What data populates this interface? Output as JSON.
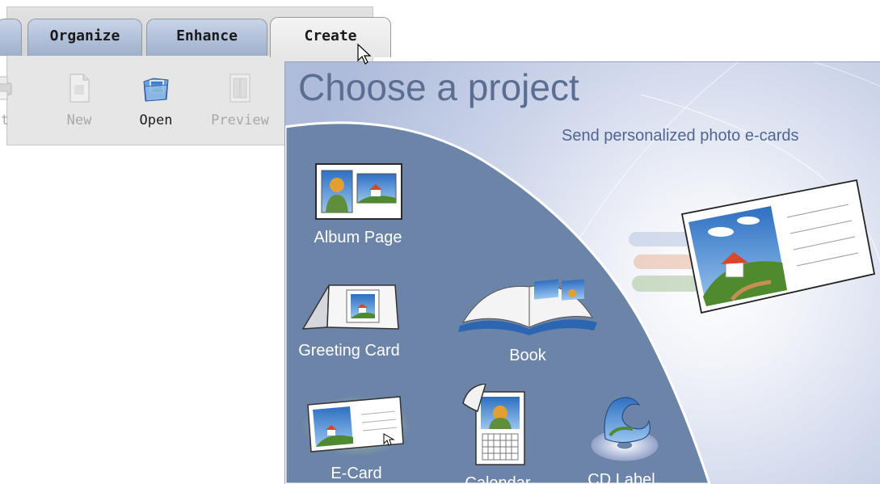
{
  "toolbar": {
    "tabs": [
      {
        "label": "Organize"
      },
      {
        "label": "Enhance"
      },
      {
        "label": "Create",
        "active": true
      }
    ],
    "tools": [
      {
        "label": "nt",
        "icon": "print-icon",
        "enabled": false
      },
      {
        "label": "New",
        "icon": "new-document-icon",
        "enabled": false
      },
      {
        "label": "Open",
        "icon": "open-folder-icon",
        "enabled": true
      },
      {
        "label": "Preview",
        "icon": "preview-icon",
        "enabled": false
      }
    ]
  },
  "panel": {
    "title": "Choose a project",
    "hint": "Send personalized photo e-cards",
    "projects": [
      {
        "label": "Album Page",
        "icon": "album-page-icon"
      },
      {
        "label": "Greeting Card",
        "icon": "greeting-card-icon"
      },
      {
        "label": "Book",
        "icon": "book-icon"
      },
      {
        "label": "E-Card",
        "icon": "ecard-icon",
        "hovered": true
      },
      {
        "label": "Calendar",
        "icon": "calendar-icon"
      },
      {
        "label": "CD Label",
        "icon": "cd-label-icon"
      }
    ]
  },
  "colors": {
    "title": "#5b6e91",
    "arc_fill": "#6b84a8",
    "tab_blue": "#a9b9d4",
    "active_tab": "#eeeeee"
  }
}
